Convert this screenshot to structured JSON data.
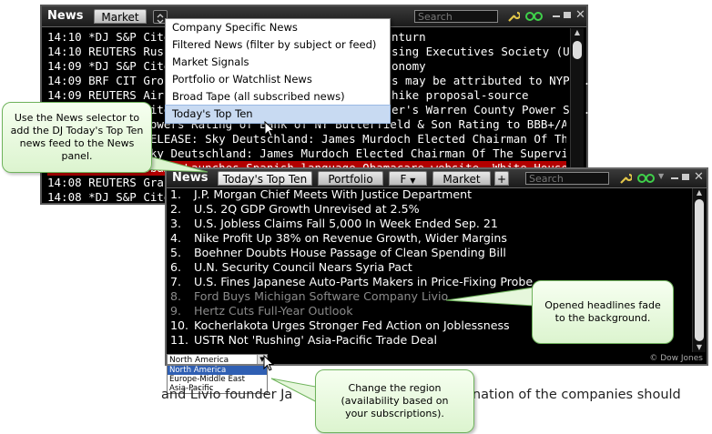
{
  "back_panel": {
    "title": "News",
    "tab": "Market",
    "search_placeholder": "Search",
    "rows": [
      "14:10 *DJ S&P Cites",
      "14:10 REUTERS Russ",
      "14:09 *DJ S&P Cites",
      "14:09 BRF CIT Group",
      "14:09 REUTERS Air F",
      "14:09 *DJ S&P Cites",
      "14:09 *DJ S&P Lowers Rating of Bank of NY Butterfield & Son Rating to BBB+/A-2 From A-/A-2",
      "14:09 REUTERS RELEASE: Sky Deutschland: James Murdoch Elected Chairman Of The Su...",
      "14:09 REUTERS Sky Deutschland: James Murdoch Elected Chairman Of The Supervisory Board",
      "14:09 REUTERS Obama Launches Spanish-language Obamacare website- White House",
      "14:08 REUTERS Gra",
      "14:08 *DJ S&P Cites"
    ],
    "rows_right": [
      "nturn",
      "sing Executives Society (USA ...",
      "onomy",
      "s may be attributed to NYPos...",
      "hike proposal-source",
      "er's Warren County Power S...",
      "",
      "",
      "",
      "",
      "",
      ""
    ]
  },
  "news_menu": {
    "items": [
      "Company Specific News",
      "Filtered News (filter by subject or feed)",
      "Market Signals",
      "Portfolio or Watchlist News",
      "Broad Tape (all subscribed news)",
      "Today's Top Ten"
    ],
    "highlighted_index": 5
  },
  "front_panel": {
    "title": "News",
    "tabs": [
      "Today's Top Ten",
      "Portfolio",
      "F",
      "Market",
      "+"
    ],
    "search_placeholder": "Search",
    "headlines": [
      {
        "num": "1.",
        "text": "J.P. Morgan Chief Meets With Justice Department",
        "faded": false
      },
      {
        "num": "2.",
        "text": "U.S. 2Q GDP Growth Unrevised at 2.5%",
        "faded": false
      },
      {
        "num": "3.",
        "text": "U.S. Jobless Claims Fall 5,000 In Week Ended Sep. 21",
        "faded": false
      },
      {
        "num": "4.",
        "text": "Nike Profit Up 38% on Revenue Growth, Wider Margins",
        "faded": false
      },
      {
        "num": "5.",
        "text": "Boehner Doubts House Passage of Clean Spending Bill",
        "faded": false
      },
      {
        "num": "6.",
        "text": "U.N. Security Council Nears Syria Pact",
        "faded": false
      },
      {
        "num": "7.",
        "text": "U.S. Fines Japanese Auto-Parts Makers in Price-Fixing Probe",
        "faded": false
      },
      {
        "num": "8.",
        "text": "Ford Buys Michigan Software Company Livio",
        "faded": true
      },
      {
        "num": "9.",
        "text": "Hertz Cuts Full-Year Outlook",
        "faded": true
      },
      {
        "num": "10.",
        "text": "Kocherlakota Urges Stronger Fed Action on Joblessness",
        "faded": false
      },
      {
        "num": "11.",
        "text": "USTR Not 'Rushing' Asia-Pacific Trade Deal",
        "faded": false
      }
    ],
    "copyright": "© Dow Jones"
  },
  "region": {
    "selected": "North America",
    "options": [
      "North America",
      "Europe-Middle East",
      "Asia-Pacific"
    ]
  },
  "below_text": "and Livio founder Ja                                          ination of the companies should",
  "callouts": {
    "selector": "Use the News selector to add the DJ Today's Top Ten news feed to the News panel.",
    "faded": "Opened headlines fade to the background.",
    "region": "Change the region (availability based on your subscriptions)."
  },
  "colors": {
    "panel_bg": "#000000",
    "selected_row": "#b30000",
    "faded_text": "#8a8a8a",
    "callout_bg": "#e6f7dc",
    "callout_border": "#6fb35c"
  }
}
